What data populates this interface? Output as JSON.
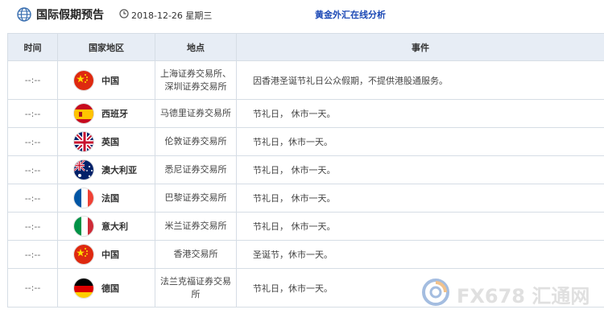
{
  "header": {
    "title": "国际假期预告",
    "date": "2018-12-26 星期三",
    "brand_link": "黄金外汇在线分析"
  },
  "table": {
    "columns": [
      "时间",
      "国家地区",
      "地点",
      "事件"
    ],
    "rows": [
      {
        "time": "--:--",
        "country": "中国",
        "flag": "cn",
        "place": "上海证券交易所、深圳证券交易所",
        "event": "因香港圣诞节礼日公众假期，不提供港股通服务。"
      },
      {
        "time": "--:--",
        "country": "西班牙",
        "flag": "es",
        "place": "马德里证券交易所",
        "event": "节礼日， 休市一天。"
      },
      {
        "time": "--:--",
        "country": "英国",
        "flag": "gb",
        "place": "伦敦证券交易所",
        "event": "节礼日，休市一天。"
      },
      {
        "time": "--:--",
        "country": "澳大利亚",
        "flag": "au",
        "place": "悉尼证券交易所",
        "event": "节礼日， 休市一天。"
      },
      {
        "time": "--:--",
        "country": "法国",
        "flag": "fr",
        "place": "巴黎证券交易所",
        "event": "节礼日， 休市一天。"
      },
      {
        "time": "--:--",
        "country": "意大利",
        "flag": "it",
        "place": "米兰证券交易所",
        "event": "节礼日， 休市一天。"
      },
      {
        "time": "--:--",
        "country": "中国",
        "flag": "cn",
        "place": "香港交易所",
        "event": "圣诞节，休市一天。"
      },
      {
        "time": "--:--",
        "country": "德国",
        "flag": "de",
        "place": "法兰克福证券交易所",
        "event": "节礼日，休市一天。"
      }
    ]
  },
  "watermark": {
    "text": "FX678 汇通网",
    "icon": "swirl-logo-icon"
  },
  "colors": {
    "header_bg": "#e7edf5",
    "border": "#d6dde5",
    "link": "#1b48b5"
  }
}
